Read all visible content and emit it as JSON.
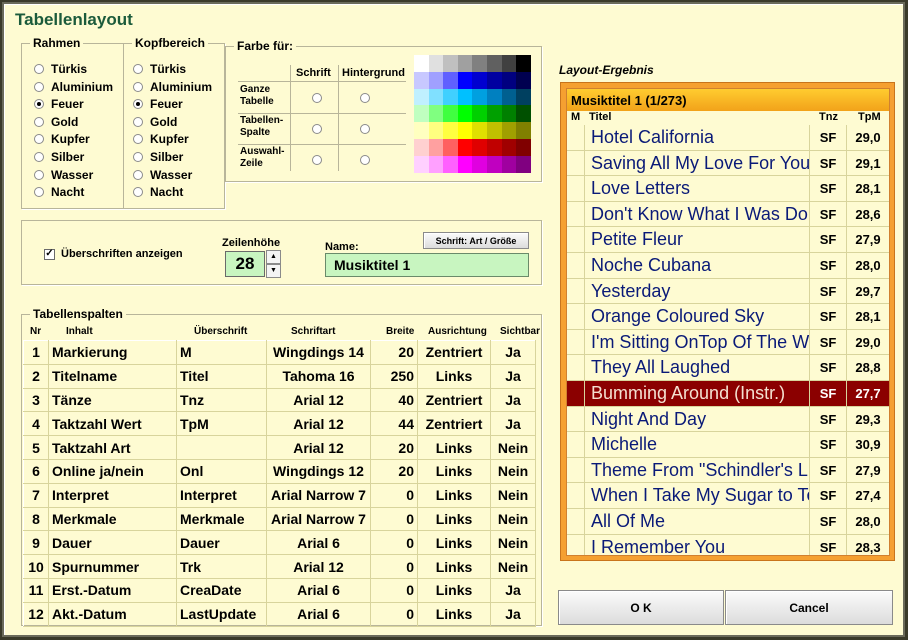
{
  "window": {
    "title": "Tabellenlayout"
  },
  "rahmen": {
    "label": "Rahmen",
    "options": [
      "Türkis",
      "Aluminium",
      "Feuer",
      "Gold",
      "Kupfer",
      "Silber",
      "Wasser",
      "Nacht"
    ],
    "selected": "Feuer"
  },
  "kopfbereich": {
    "label": "Kopfbereich",
    "options": [
      "Türkis",
      "Aluminium",
      "Feuer",
      "Gold",
      "Kupfer",
      "Silber",
      "Wasser",
      "Nacht"
    ],
    "selected": "Feuer"
  },
  "farbe": {
    "label": "Farbe für:",
    "col_schrift": "Schrift",
    "col_hintergrund": "Hintergrund",
    "rows": [
      {
        "label": "Ganze Tabelle"
      },
      {
        "label": "Tabellen-Spalte"
      },
      {
        "label": "Auswahl-Zeile"
      }
    ],
    "palette": [
      [
        "#ffffff",
        "#e0e0e0",
        "#c0c0c0",
        "#a0a0a0",
        "#808080",
        "#606060",
        "#404040",
        "#000000"
      ],
      [
        "#c8c8ff",
        "#a0a0ff",
        "#6060ff",
        "#0000ff",
        "#0000d0",
        "#0000a0",
        "#000080",
        "#000050"
      ],
      [
        "#c0f0ff",
        "#80e0ff",
        "#40d0ff",
        "#00c0ff",
        "#00a0e0",
        "#0080c0",
        "#006090",
        "#004060"
      ],
      [
        "#c0ffc0",
        "#80ff80",
        "#40ff40",
        "#00ff00",
        "#00d000",
        "#00a000",
        "#008000",
        "#005000"
      ],
      [
        "#ffffc0",
        "#ffff80",
        "#ffff40",
        "#ffff00",
        "#e0e000",
        "#c0c000",
        "#a0a000",
        "#808000"
      ],
      [
        "#ffd0d0",
        "#ffa0a0",
        "#ff6060",
        "#ff0000",
        "#e00000",
        "#c00000",
        "#a00000",
        "#800000"
      ],
      [
        "#ffd0ff",
        "#ffa0ff",
        "#ff60ff",
        "#ff00ff",
        "#e000e0",
        "#c000c0",
        "#a000a0",
        "#800080"
      ]
    ]
  },
  "options": {
    "show_headers_label": "Überschriften anzeigen",
    "show_headers_checked": true,
    "row_height_label": "Zeilenhöhe",
    "row_height_value": "28",
    "name_label": "Name:",
    "name_value": "Musiktitel 1",
    "font_button_label": "Schrift: Art / Größe"
  },
  "columns_table": {
    "label": "Tabellenspalten",
    "headers": [
      "Nr",
      "Inhalt",
      "Überschrift",
      "Schriftart",
      "Breite",
      "Ausrichtung",
      "Sichtbar"
    ],
    "rows": [
      [
        "1",
        "Markierung",
        "M",
        "Wingdings 14",
        "20",
        "Zentriert",
        "Ja"
      ],
      [
        "2",
        "Titelname",
        "Titel",
        "Tahoma 16",
        "250",
        "Links",
        "Ja"
      ],
      [
        "3",
        "Tänze",
        "Tnz",
        "Arial 12",
        "40",
        "Zentriert",
        "Ja"
      ],
      [
        "4",
        "Taktzahl Wert",
        "TpM",
        "Arial 12",
        "44",
        "Zentriert",
        "Ja"
      ],
      [
        "5",
        "Taktzahl Art",
        "",
        "Arial 12",
        "20",
        "Links",
        "Nein"
      ],
      [
        "6",
        "Online ja/nein",
        "Onl",
        "Wingdings 12",
        "20",
        "Links",
        "Nein"
      ],
      [
        "7",
        "Interpret",
        "Interpret",
        "Arial Narrow 7",
        "0",
        "Links",
        "Nein"
      ],
      [
        "8",
        "Merkmale",
        "Merkmale",
        "Arial Narrow 7",
        "0",
        "Links",
        "Nein"
      ],
      [
        "9",
        "Dauer",
        "Dauer",
        "Arial 6",
        "0",
        "Links",
        "Nein"
      ],
      [
        "10",
        "Spurnummer",
        "Trk",
        "Arial 12",
        "0",
        "Links",
        "Nein"
      ],
      [
        "11",
        "Erst.-Datum",
        "CreaDate",
        "Arial 6",
        "0",
        "Links",
        "Ja"
      ],
      [
        "12",
        "Akt.-Datum",
        "LastUpdate",
        "Arial 6",
        "0",
        "Links",
        "Ja"
      ]
    ]
  },
  "result": {
    "label": "Layout-Ergebnis",
    "title": "Musiktitel 1 (1/273)",
    "headers": {
      "m": "M",
      "title": "Titel",
      "tnz": "Tnz",
      "tpm": "TpM"
    },
    "rows": [
      {
        "title": "Hotel California",
        "tnz": "SF",
        "tpm": "29,0"
      },
      {
        "title": "Saving All My Love For You",
        "tnz": "SF",
        "tpm": "29,1"
      },
      {
        "title": "Love Letters",
        "tnz": "SF",
        "tpm": "28,1"
      },
      {
        "title": "Don't Know What I Was Doing",
        "tnz": "SF",
        "tpm": "28,6"
      },
      {
        "title": "Petite Fleur",
        "tnz": "SF",
        "tpm": "27,9"
      },
      {
        "title": "Noche Cubana",
        "tnz": "SF",
        "tpm": "28,0"
      },
      {
        "title": "Yesterday",
        "tnz": "SF",
        "tpm": "29,7"
      },
      {
        "title": "Orange Coloured Sky",
        "tnz": "SF",
        "tpm": "28,1"
      },
      {
        "title": "I'm Sitting OnTop Of The World",
        "tnz": "SF",
        "tpm": "29,0"
      },
      {
        "title": "They All Laughed",
        "tnz": "SF",
        "tpm": "28,8"
      },
      {
        "title": "Bumming Around (Instr.)",
        "tnz": "SF",
        "tpm": "27,7",
        "selected": true
      },
      {
        "title": "Night And Day",
        "tnz": "SF",
        "tpm": "29,3"
      },
      {
        "title": "Michelle",
        "tnz": "SF",
        "tpm": "30,9"
      },
      {
        "title": "Theme From \"Schindler's List\"",
        "tnz": "SF",
        "tpm": "27,9"
      },
      {
        "title": "When I Take My Sugar to Tea",
        "tnz": "SF",
        "tpm": "27,4"
      },
      {
        "title": "All Of Me",
        "tnz": "SF",
        "tpm": "28,0"
      },
      {
        "title": "I Remember You",
        "tnz": "SF",
        "tpm": "28,3"
      }
    ]
  },
  "buttons": {
    "ok": "O K",
    "cancel": "Cancel"
  }
}
